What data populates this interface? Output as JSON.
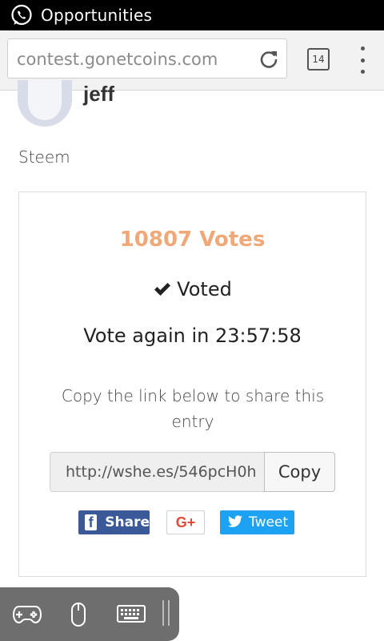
{
  "status_bar": {
    "title": "Opportunities",
    "app_icon": "whatsapp-icon"
  },
  "browser": {
    "url": "contest.gonetcoins.com",
    "tab_count": "14"
  },
  "entry": {
    "author": "jeff",
    "category": "Steem",
    "votes_label": "10807 Votes",
    "voted_label": "Voted",
    "vote_again": "Vote again in 23:57:58",
    "copy_instructions": "Copy the link below to share this entry",
    "share_link": "http://wshe.es/546pcH0h",
    "copy_label": "Copy"
  },
  "share": {
    "facebook_label": "Share",
    "google_label": "G+",
    "twitter_label": "Tweet"
  },
  "colors": {
    "votes_accent": "#f0a878",
    "facebook": "#3b5998",
    "google": "#dd4b39",
    "twitter": "#1da1f2"
  },
  "floating_toolbar": {
    "icons": [
      "gamepad-icon",
      "mouse-icon",
      "keyboard-icon"
    ]
  }
}
